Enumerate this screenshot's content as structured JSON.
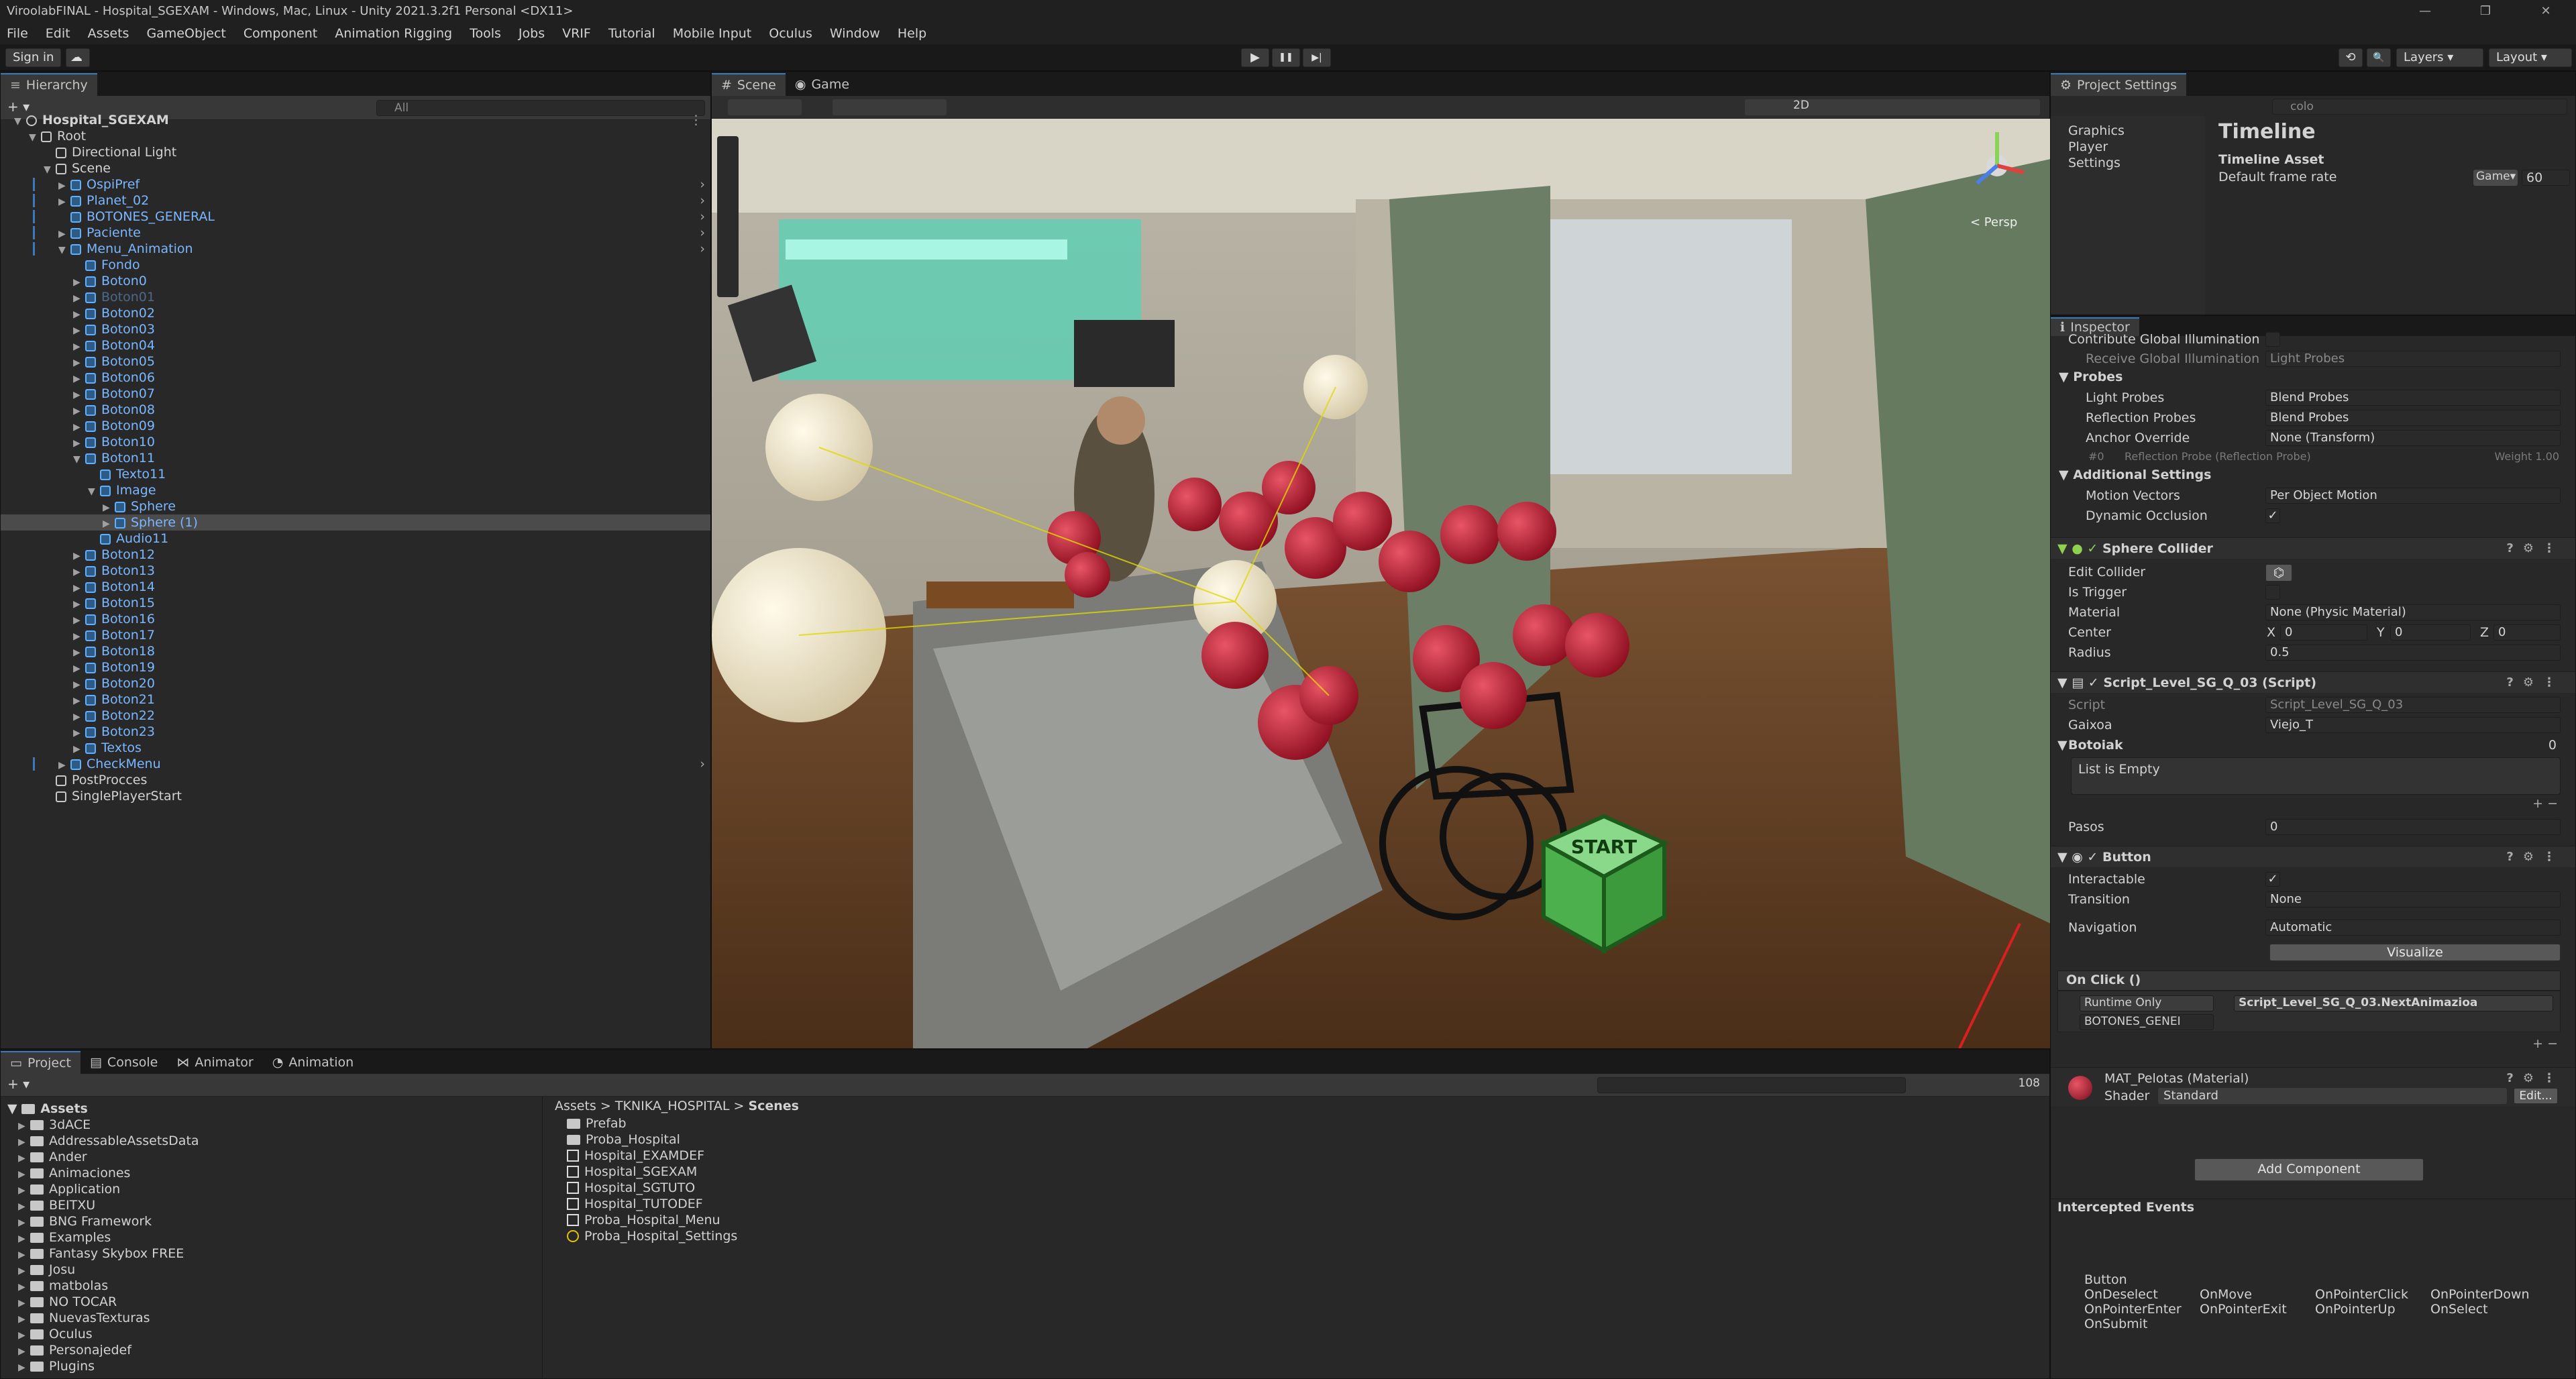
{
  "window": {
    "title": "ViroolabFINAL - Hospital_SGEXAM - Windows, Mac, Linux - Unity 2021.3.2f1 Personal <DX11>",
    "controls": [
      "—",
      "❐",
      "✕"
    ]
  },
  "menu": [
    "File",
    "Edit",
    "Assets",
    "GameObject",
    "Component",
    "Animation Rigging",
    "Tools",
    "Jobs",
    "VRIF",
    "Tutorial",
    "Mobile Input",
    "Oculus",
    "Window",
    "Help"
  ],
  "toolbar": {
    "sign_in": "Sign in",
    "cloud": "☁",
    "play": "▶",
    "pause": "❚❚",
    "step": "▶|",
    "history": "⟲",
    "search": "🔍",
    "layers": "Layers",
    "layout": "Layout"
  },
  "hierarchy": {
    "tab": "Hierarchy",
    "add": "+ ▾",
    "search_placeholder": "All",
    "items": [
      {
        "label": "Hospital_SGEXAM",
        "indent": 0,
        "fold": "▼",
        "kind": "scene",
        "bold": true
      },
      {
        "label": "Root",
        "indent": 1,
        "fold": "▼",
        "kind": "obj"
      },
      {
        "label": "Directional Light",
        "indent": 2,
        "fold": "",
        "kind": "obj"
      },
      {
        "label": "Scene",
        "indent": 2,
        "fold": "▼",
        "kind": "obj"
      },
      {
        "label": "OspiPref",
        "indent": 3,
        "fold": "▶",
        "kind": "prefab",
        "arrow": true
      },
      {
        "label": "Planet_02",
        "indent": 3,
        "fold": "▶",
        "kind": "prefab",
        "arrow": true
      },
      {
        "label": "BOTONES_GENERAL",
        "indent": 3,
        "fold": "",
        "kind": "prefab",
        "arrow": true
      },
      {
        "label": "Paciente",
        "indent": 3,
        "fold": "▶",
        "kind": "prefab",
        "arrow": true
      },
      {
        "label": "Menu_Animation",
        "indent": 3,
        "fold": "▼",
        "kind": "prefab",
        "arrow": true
      },
      {
        "label": "Fondo",
        "indent": 4,
        "fold": "",
        "kind": "pobj"
      },
      {
        "label": "Boton0",
        "indent": 4,
        "fold": "▶",
        "kind": "pobj"
      },
      {
        "label": "Boton01",
        "indent": 4,
        "fold": "▶",
        "kind": "pobj",
        "dim": true
      },
      {
        "label": "Boton02",
        "indent": 4,
        "fold": "▶",
        "kind": "pobj"
      },
      {
        "label": "Boton03",
        "indent": 4,
        "fold": "▶",
        "kind": "pobj"
      },
      {
        "label": "Boton04",
        "indent": 4,
        "fold": "▶",
        "kind": "pobj"
      },
      {
        "label": "Boton05",
        "indent": 4,
        "fold": "▶",
        "kind": "pobj"
      },
      {
        "label": "Boton06",
        "indent": 4,
        "fold": "▶",
        "kind": "pobj"
      },
      {
        "label": "Boton07",
        "indent": 4,
        "fold": "▶",
        "kind": "pobj"
      },
      {
        "label": "Boton08",
        "indent": 4,
        "fold": "▶",
        "kind": "pobj"
      },
      {
        "label": "Boton09",
        "indent": 4,
        "fold": "▶",
        "kind": "pobj"
      },
      {
        "label": "Boton10",
        "indent": 4,
        "fold": "▶",
        "kind": "pobj"
      },
      {
        "label": "Boton11",
        "indent": 4,
        "fold": "▼",
        "kind": "pobj"
      },
      {
        "label": "Texto11",
        "indent": 5,
        "fold": "",
        "kind": "pobj"
      },
      {
        "label": "Image",
        "indent": 5,
        "fold": "▼",
        "kind": "pobj"
      },
      {
        "label": "Sphere",
        "indent": 6,
        "fold": "▶",
        "kind": "pobj"
      },
      {
        "label": "Sphere (1)",
        "indent": 6,
        "fold": "▶",
        "kind": "pobj",
        "selected": true
      },
      {
        "label": "Audio11",
        "indent": 5,
        "fold": "",
        "kind": "pobj"
      },
      {
        "label": "Boton12",
        "indent": 4,
        "fold": "▶",
        "kind": "pobj"
      },
      {
        "label": "Boton13",
        "indent": 4,
        "fold": "▶",
        "kind": "pobj"
      },
      {
        "label": "Boton14",
        "indent": 4,
        "fold": "▶",
        "kind": "pobj"
      },
      {
        "label": "Boton15",
        "indent": 4,
        "fold": "▶",
        "kind": "pobj"
      },
      {
        "label": "Boton16",
        "indent": 4,
        "fold": "▶",
        "kind": "pobj"
      },
      {
        "label": "Boton17",
        "indent": 4,
        "fold": "▶",
        "kind": "pobj"
      },
      {
        "label": "Boton18",
        "indent": 4,
        "fold": "▶",
        "kind": "pobj"
      },
      {
        "label": "Boton19",
        "indent": 4,
        "fold": "▶",
        "kind": "pobj"
      },
      {
        "label": "Boton20",
        "indent": 4,
        "fold": "▶",
        "kind": "pobj"
      },
      {
        "label": "Boton21",
        "indent": 4,
        "fold": "▶",
        "kind": "pobj"
      },
      {
        "label": "Boton22",
        "indent": 4,
        "fold": "▶",
        "kind": "pobj"
      },
      {
        "label": "Boton23",
        "indent": 4,
        "fold": "▶",
        "kind": "pobj"
      },
      {
        "label": "Textos",
        "indent": 4,
        "fold": "▶",
        "kind": "pobj"
      },
      {
        "label": "CheckMenu",
        "indent": 3,
        "fold": "▶",
        "kind": "prefab",
        "arrow": true
      },
      {
        "label": "PostProcces",
        "indent": 2,
        "fold": "",
        "kind": "obj"
      },
      {
        "label": "SinglePlayerStart",
        "indent": 2,
        "fold": "",
        "kind": "obj"
      }
    ]
  },
  "scene": {
    "tabs": [
      "Scene",
      "Game"
    ],
    "mode_2d": "2D",
    "persp": "< Persp",
    "cube_text": "START"
  },
  "project_settings": {
    "tab": "Project Settings",
    "search": "colo",
    "categories": [
      "Graphics",
      "Player",
      "Settings"
    ],
    "title": "Timeline",
    "section": "Timeline Asset",
    "field": "Default frame rate",
    "dropdown": "Game",
    "value": "60"
  },
  "inspector": {
    "tab": "Inspector",
    "top_rows": [
      {
        "label": "Contribute Global Illumination",
        "value": "",
        "check": true
      },
      {
        "label": "Receive Global Illumination",
        "value": "Light Probes",
        "dim": true
      }
    ],
    "probes_title": "Probes",
    "probes": [
      {
        "label": "Light Probes",
        "value": "Blend Probes"
      },
      {
        "label": "Reflection Probes",
        "value": "Blend Probes"
      },
      {
        "label": "Anchor Override",
        "value": "None (Transform)"
      }
    ],
    "probe_note": "Reflection Probe (Reflection Probe)",
    "probe_weight": "Weight 1.00",
    "probe_idx": "#0",
    "additional_title": "Additional Settings",
    "additional": [
      {
        "label": "Motion Vectors",
        "value": "Per Object Motion"
      },
      {
        "label": "Dynamic Occlusion",
        "value": "✓"
      }
    ],
    "sphere_collider": {
      "title": "Sphere Collider",
      "edit": "Edit Collider",
      "trigger": "Is Trigger",
      "material_label": "Material",
      "material": "None (Physic Material)",
      "center_label": "Center",
      "cx": "0",
      "cy": "0",
      "cz": "0",
      "radius_label": "Radius",
      "radius": "0.5"
    },
    "script_comp": {
      "title": "Script_Level_SG_Q_03 (Script)",
      "script_label": "Script",
      "script": "Script_Level_SG_Q_03",
      "gaixoa_label": "Gaixoa",
      "gaixoa": "Viejo_T",
      "botoiak_label": "Botoiak",
      "botoiak_count": "0",
      "empty": "List is Empty",
      "pasos_label": "Pasos",
      "pasos": "0"
    },
    "button_comp": {
      "title": "Button",
      "interactable": "Interactable",
      "transition_label": "Transition",
      "transition": "None",
      "navigation_label": "Navigation",
      "navigation": "Automatic",
      "visualize": "Visualize",
      "onclick": "On Click ()",
      "runtime": "Runtime Only",
      "function": "Script_Level_SG_Q_03.NextAnimazioa",
      "target": "BOTONES_GENEI"
    },
    "material": {
      "name": "MAT_Pelotas (Material)",
      "shader_label": "Shader",
      "shader": "Standard",
      "edit": "Edit..."
    },
    "add_component": "Add Component",
    "intercepted_title": "Intercepted Events",
    "events_header": "Button",
    "events": [
      [
        "OnDeselect",
        "OnMove",
        "OnPointerClick",
        "OnPointerDown"
      ],
      [
        "OnPointerEnter",
        "OnPointerExit",
        "OnPointerUp",
        "OnSelect"
      ],
      [
        "OnSubmit",
        "",
        "",
        ""
      ]
    ]
  },
  "bottom": {
    "tabs": [
      "Project",
      "Console",
      "Animator",
      "Animation"
    ],
    "count": "108",
    "tree_root": "Assets",
    "tree": [
      "3dACE",
      "AddressableAssetsData",
      "Ander",
      "Animaciones",
      "Application",
      "BEITXU",
      "BNG Framework",
      "Examples",
      "Fantasy Skybox FREE",
      "Josu",
      "matbolas",
      "NO TOCAR",
      "NuevasTexturas",
      "Oculus",
      "Personajedef",
      "Plugins"
    ],
    "breadcrumb": [
      "Assets",
      "TKNIKA_HOSPITAL",
      "Scenes"
    ],
    "files": [
      {
        "name": "Prefab",
        "type": "folder"
      },
      {
        "name": "Proba_Hospital",
        "type": "folder"
      },
      {
        "name": "Hospital_EXAMDEF",
        "type": "scene"
      },
      {
        "name": "Hospital_SGEXAM",
        "type": "scene"
      },
      {
        "name": "Hospital_SGTUTO",
        "type": "scene"
      },
      {
        "name": "Hospital_TUTODEF",
        "type": "scene"
      },
      {
        "name": "Proba_Hospital_Menu",
        "type": "scene"
      },
      {
        "name": "Proba_Hospital_Settings",
        "type": "settings"
      }
    ]
  }
}
